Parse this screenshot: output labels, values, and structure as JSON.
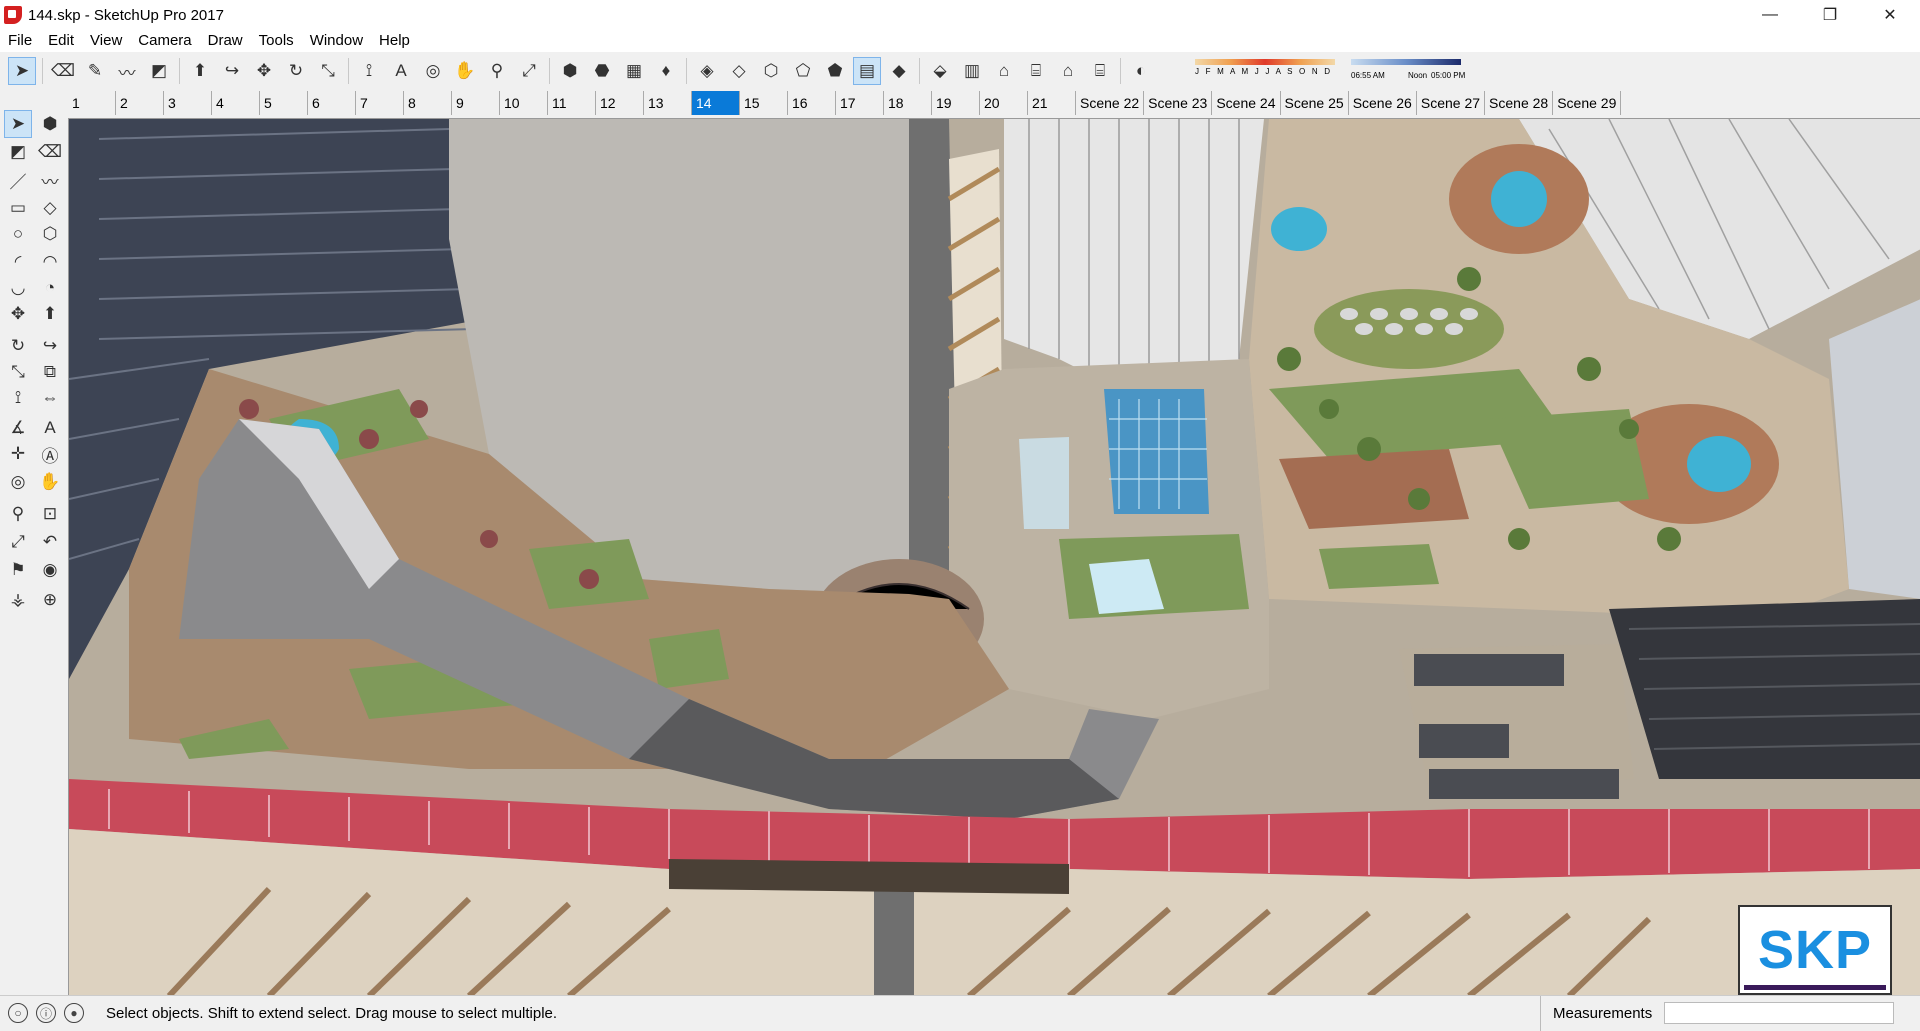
{
  "window": {
    "title": "144.skp - SketchUp Pro 2017",
    "minimize_glyph": "—",
    "restore_glyph": "❐",
    "close_glyph": "✕"
  },
  "menu": [
    "File",
    "Edit",
    "View",
    "Camera",
    "Draw",
    "Tools",
    "Window",
    "Help"
  ],
  "toolbar": {
    "icons": [
      "select-icon",
      "eraser-icon",
      "pencil-icon",
      "freehand-icon",
      "paint-icon",
      "push-pull-icon",
      "follow-me-icon",
      "move-icon",
      "rotate-icon",
      "scale-icon",
      "tape-icon",
      "text-icon",
      "orbit-icon",
      "pan-icon",
      "zoom-icon",
      "zoom-extents-icon",
      "component-icon",
      "warehouse-icon",
      "extension-icon",
      "ruby-icon",
      "xray-icon",
      "back-edges-icon",
      "wireframe-icon",
      "hidden-line-icon",
      "shaded-icon",
      "shaded-texture-icon",
      "monochrome-icon",
      "iso-view-icon",
      "top-view-icon",
      "front-view-icon",
      "right-view-icon",
      "back-view-icon",
      "left-view-icon",
      "shadow-toggle-icon"
    ],
    "shadow": {
      "months": "J F M A M J J A S O N D",
      "time_start": "06:55 AM",
      "time_noon": "Noon",
      "time_end": "05:00 PM"
    }
  },
  "scene_tabs": [
    "1",
    "2",
    "3",
    "4",
    "5",
    "6",
    "7",
    "8",
    "9",
    "10",
    "11",
    "12",
    "13",
    "14",
    "15",
    "16",
    "17",
    "18",
    "19",
    "20",
    "21",
    "Scene 22",
    "Scene 23",
    "Scene 24",
    "Scene 25",
    "Scene 26",
    "Scene 27",
    "Scene 28",
    "Scene 29"
  ],
  "active_scene": "14",
  "palette_icons": [
    "select-icon",
    "component-icon",
    "paint-bucket-icon",
    "eraser-icon",
    "line-icon",
    "freehand-icon",
    "rectangle-icon",
    "rotated-rectangle-icon",
    "circle-icon",
    "polygon-icon",
    "arc-icon",
    "two-point-arc-icon",
    "three-point-arc-icon",
    "pie-icon",
    "move-icon",
    "push-pull-icon",
    "rotate-icon",
    "follow-me-icon",
    "scale-icon",
    "offset-icon",
    "tape-measure-icon",
    "dimension-icon",
    "protractor-icon",
    "text-icon",
    "axes-icon",
    "3d-text-icon",
    "orbit-icon",
    "pan-icon",
    "zoom-icon",
    "zoom-window-icon",
    "zoom-extents-icon",
    "previous-view-icon",
    "position-camera-icon",
    "look-around-icon",
    "walk-icon",
    "section-plane-icon"
  ],
  "viewport": {
    "logo_text": "SKP"
  },
  "status": {
    "hint": "Select objects. Shift to extend select. Drag mouse to select multiple.",
    "measurements_label": "Measurements"
  }
}
